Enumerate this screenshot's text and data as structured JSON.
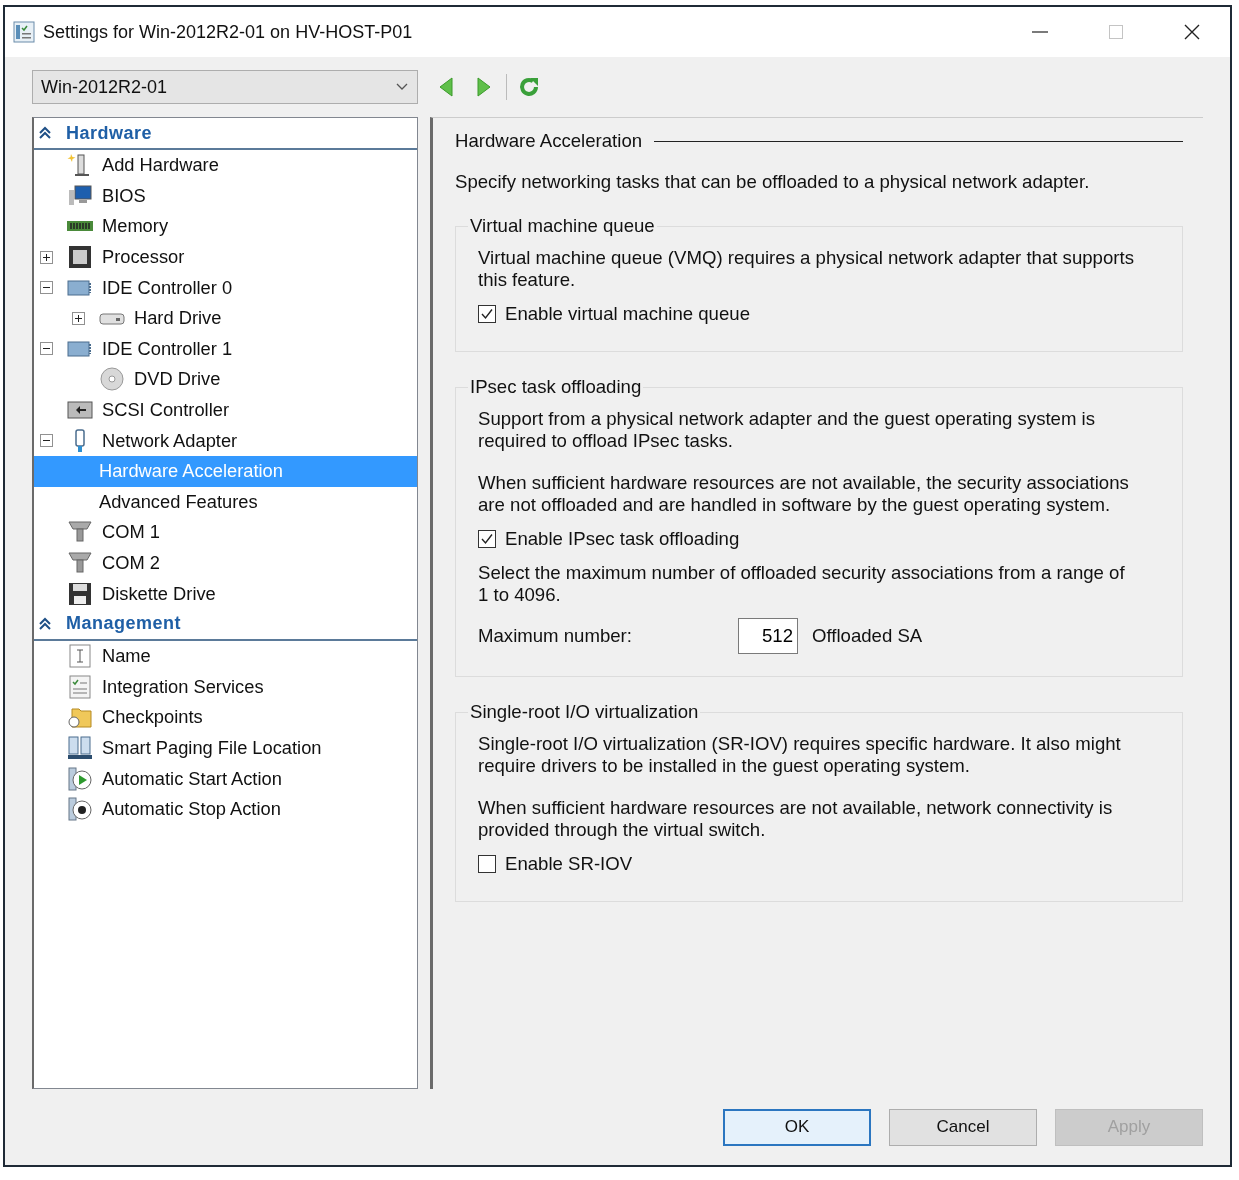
{
  "window": {
    "title": "Settings for Win-2012R2-01 on HV-HOST-P01",
    "maximize_disabled": true
  },
  "toolbar": {
    "vm_select": {
      "value": "Win-2012R2-01"
    }
  },
  "sidebar": {
    "sections": [
      {
        "title": "Hardware",
        "items": [
          {
            "label": "Add Hardware",
            "kind": "add-hardware",
            "selected": false
          },
          {
            "label": "BIOS",
            "kind": "bios",
            "selected": false
          },
          {
            "label": "Memory",
            "kind": "memory",
            "selected": false
          },
          {
            "label": "Processor",
            "kind": "processor",
            "selected": false,
            "expanded": false
          },
          {
            "label": "IDE Controller 0",
            "kind": "controller",
            "selected": false,
            "expanded": true,
            "children": [
              {
                "label": "Hard Drive",
                "kind": "hard-drive",
                "selected": false,
                "expanded": false
              }
            ]
          },
          {
            "label": "IDE Controller 1",
            "kind": "controller",
            "selected": false,
            "expanded": true,
            "children": [
              {
                "label": "DVD Drive",
                "kind": "dvd",
                "selected": false
              }
            ]
          },
          {
            "label": "SCSI Controller",
            "kind": "scsi",
            "selected": false
          },
          {
            "label": "Network Adapter",
            "kind": "network",
            "selected": false,
            "expanded": true,
            "children": [
              {
                "label": "Hardware Acceleration",
                "selected": true
              },
              {
                "label": "Advanced Features",
                "selected": false
              }
            ]
          },
          {
            "label": "COM 1",
            "kind": "com",
            "selected": false
          },
          {
            "label": "COM 2",
            "kind": "com",
            "selected": false
          },
          {
            "label": "Diskette Drive",
            "kind": "diskette",
            "selected": false
          }
        ]
      },
      {
        "title": "Management",
        "items": [
          {
            "label": "Name",
            "kind": "name",
            "selected": false
          },
          {
            "label": "Integration Services",
            "kind": "checklist",
            "selected": false
          },
          {
            "label": "Checkpoints",
            "kind": "checkpoint",
            "selected": false
          },
          {
            "label": "Smart Paging File Location",
            "kind": "paging",
            "selected": false
          },
          {
            "label": "Automatic Start Action",
            "kind": "start",
            "selected": false
          },
          {
            "label": "Automatic Stop Action",
            "kind": "stop",
            "selected": false
          }
        ]
      }
    ]
  },
  "panel": {
    "title": "Hardware Acceleration",
    "description": "Specify networking tasks that can be offloaded to a physical network adapter.",
    "groups": [
      {
        "legend": "Virtual machine queue",
        "content": [
          {
            "kind": "text",
            "text": "Virtual machine queue (VMQ) requires a physical network adapter that supports this feature."
          },
          {
            "kind": "checkbox",
            "label": "Enable virtual machine queue",
            "checked": true
          }
        ]
      },
      {
        "legend": "IPsec task offloading",
        "content": [
          {
            "kind": "text",
            "text": "Support from a physical network adapter and the guest operating system is required to offload IPsec tasks."
          },
          {
            "kind": "text",
            "text": "When sufficient hardware resources are not available, the security associations are not offloaded and are handled in software by the guest operating system."
          },
          {
            "kind": "checkbox",
            "label": "Enable IPsec task offloading",
            "checked": true
          },
          {
            "kind": "text",
            "text": "Select the maximum number of offloaded security associations from a range of 1 to 4096."
          },
          {
            "kind": "number",
            "label": "Maximum number:",
            "value": "512",
            "unit": "Offloaded SA"
          }
        ]
      },
      {
        "legend": "Single-root I/O virtualization",
        "content": [
          {
            "kind": "text",
            "text": "Single-root I/O virtualization (SR-IOV) requires specific hardware. It also might require drivers to be installed in the guest operating system."
          },
          {
            "kind": "text",
            "text": "When sufficient hardware resources are not available, network connectivity is provided through the virtual switch."
          },
          {
            "kind": "checkbox",
            "label": "Enable SR-IOV",
            "checked": false
          }
        ]
      }
    ]
  },
  "buttons": [
    {
      "label": "OK",
      "default": true,
      "disabled": false
    },
    {
      "label": "Cancel",
      "default": false,
      "disabled": false
    },
    {
      "label": "Apply",
      "default": false,
      "disabled": true
    }
  ]
}
